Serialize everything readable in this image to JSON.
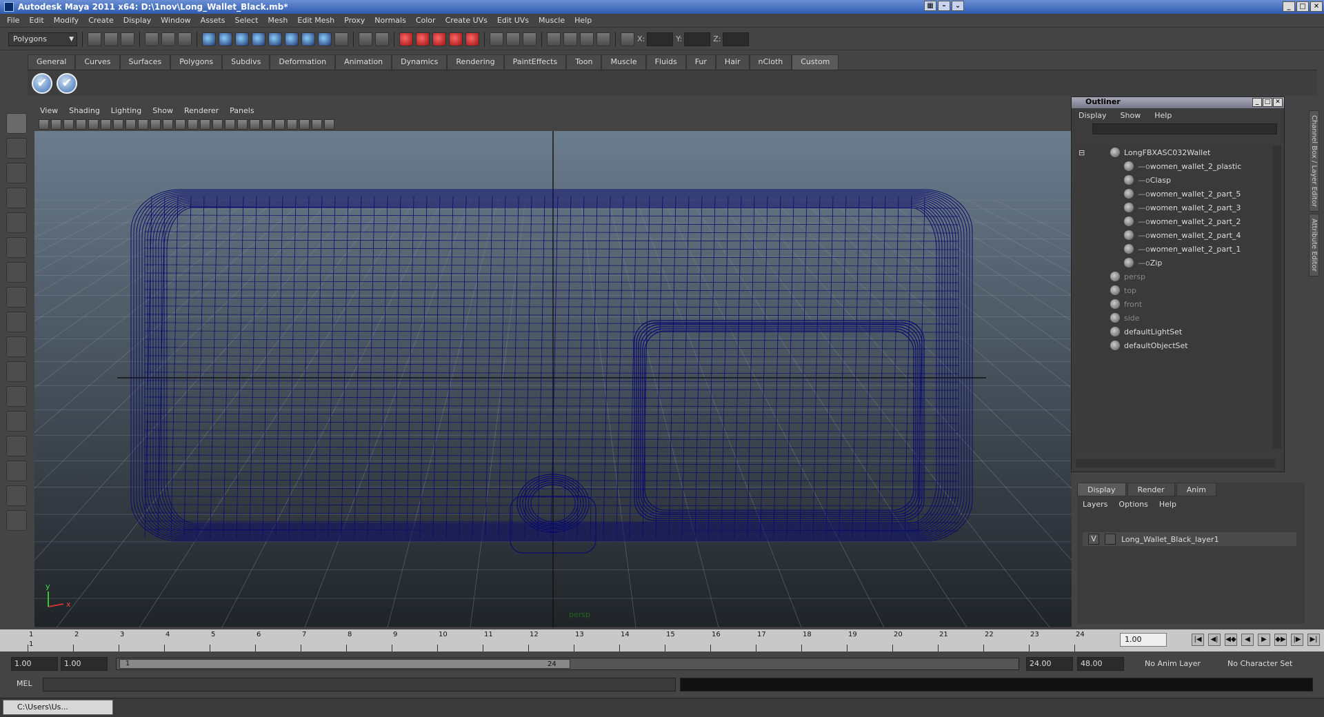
{
  "window": {
    "title": "Autodesk Maya 2011 x64: D:\\1nov\\Long_Wallet_Black.mb*"
  },
  "menubar": [
    "File",
    "Edit",
    "Modify",
    "Create",
    "Display",
    "Window",
    "Assets",
    "Select",
    "Mesh",
    "Edit Mesh",
    "Proxy",
    "Normals",
    "Color",
    "Create UVs",
    "Edit UVs",
    "Muscle",
    "Help"
  ],
  "status": {
    "mode": "Polygons",
    "x_label": "X:",
    "y_label": "Y:",
    "z_label": "Z:"
  },
  "shelf_tabs": [
    "General",
    "Curves",
    "Surfaces",
    "Polygons",
    "Subdivs",
    "Deformation",
    "Animation",
    "Dynamics",
    "Rendering",
    "PaintEffects",
    "Toon",
    "Muscle",
    "Fluids",
    "Fur",
    "Hair",
    "nCloth",
    "Custom"
  ],
  "shelf_active": "Custom",
  "viewport": {
    "menu": [
      "View",
      "Shading",
      "Lighting",
      "Show",
      "Renderer",
      "Panels"
    ],
    "camera_label": "persp",
    "axis_x": "x",
    "axis_y": "y"
  },
  "outliner": {
    "title": "Outliner",
    "menu": [
      "Display",
      "Show",
      "Help"
    ],
    "items": [
      {
        "label": "LongFBXASC032Wallet",
        "depth": 0,
        "dim": false
      },
      {
        "label": "women_wallet_2_plastic",
        "depth": 1,
        "dim": false
      },
      {
        "label": "Clasp",
        "depth": 1,
        "dim": false
      },
      {
        "label": "women_wallet_2_part_5",
        "depth": 1,
        "dim": false
      },
      {
        "label": "women_wallet_2_part_3",
        "depth": 1,
        "dim": false
      },
      {
        "label": "women_wallet_2_part_2",
        "depth": 1,
        "dim": false
      },
      {
        "label": "women_wallet_2_part_4",
        "depth": 1,
        "dim": false
      },
      {
        "label": "women_wallet_2_part_1",
        "depth": 1,
        "dim": false
      },
      {
        "label": "Zip",
        "depth": 1,
        "dim": false
      },
      {
        "label": "persp",
        "depth": 0,
        "dim": true
      },
      {
        "label": "top",
        "depth": 0,
        "dim": true
      },
      {
        "label": "front",
        "depth": 0,
        "dim": true
      },
      {
        "label": "side",
        "depth": 0,
        "dim": true
      },
      {
        "label": "defaultLightSet",
        "depth": 0,
        "dim": false
      },
      {
        "label": "defaultObjectSet",
        "depth": 0,
        "dim": false
      }
    ]
  },
  "side_tabs": [
    "Channel Box / Layer Editor",
    "Attribute Editor"
  ],
  "layers": {
    "tabs": [
      "Display",
      "Render",
      "Anim"
    ],
    "menu": [
      "Layers",
      "Options",
      "Help"
    ],
    "layer_visible": "V",
    "layer_name": "Long_Wallet_Black_layer1"
  },
  "timeline": {
    "frames": [
      "1",
      "2",
      "3",
      "4",
      "5",
      "6",
      "7",
      "8",
      "9",
      "10",
      "11",
      "12",
      "13",
      "14",
      "15",
      "16",
      "17",
      "18",
      "19",
      "20",
      "21",
      "22",
      "23",
      "24"
    ],
    "current_frame_marker": "1",
    "current_frame": "1.00"
  },
  "range": {
    "start": "1.00",
    "playback_start": "1.00",
    "thumb_start": "1",
    "thumb_end": "24",
    "playback_end": "24.00",
    "end": "48.00",
    "anim_layer": "No Anim Layer",
    "character_set": "No Character Set"
  },
  "cmd": {
    "label": "MEL"
  },
  "taskbar": {
    "item": "C:\\Users\\Us..."
  },
  "colors": {
    "wire": "#0b0b6e",
    "title_bar": "#2f5bb0",
    "viewport_top": "#6b7c8d",
    "viewport_bottom": "#202428"
  }
}
